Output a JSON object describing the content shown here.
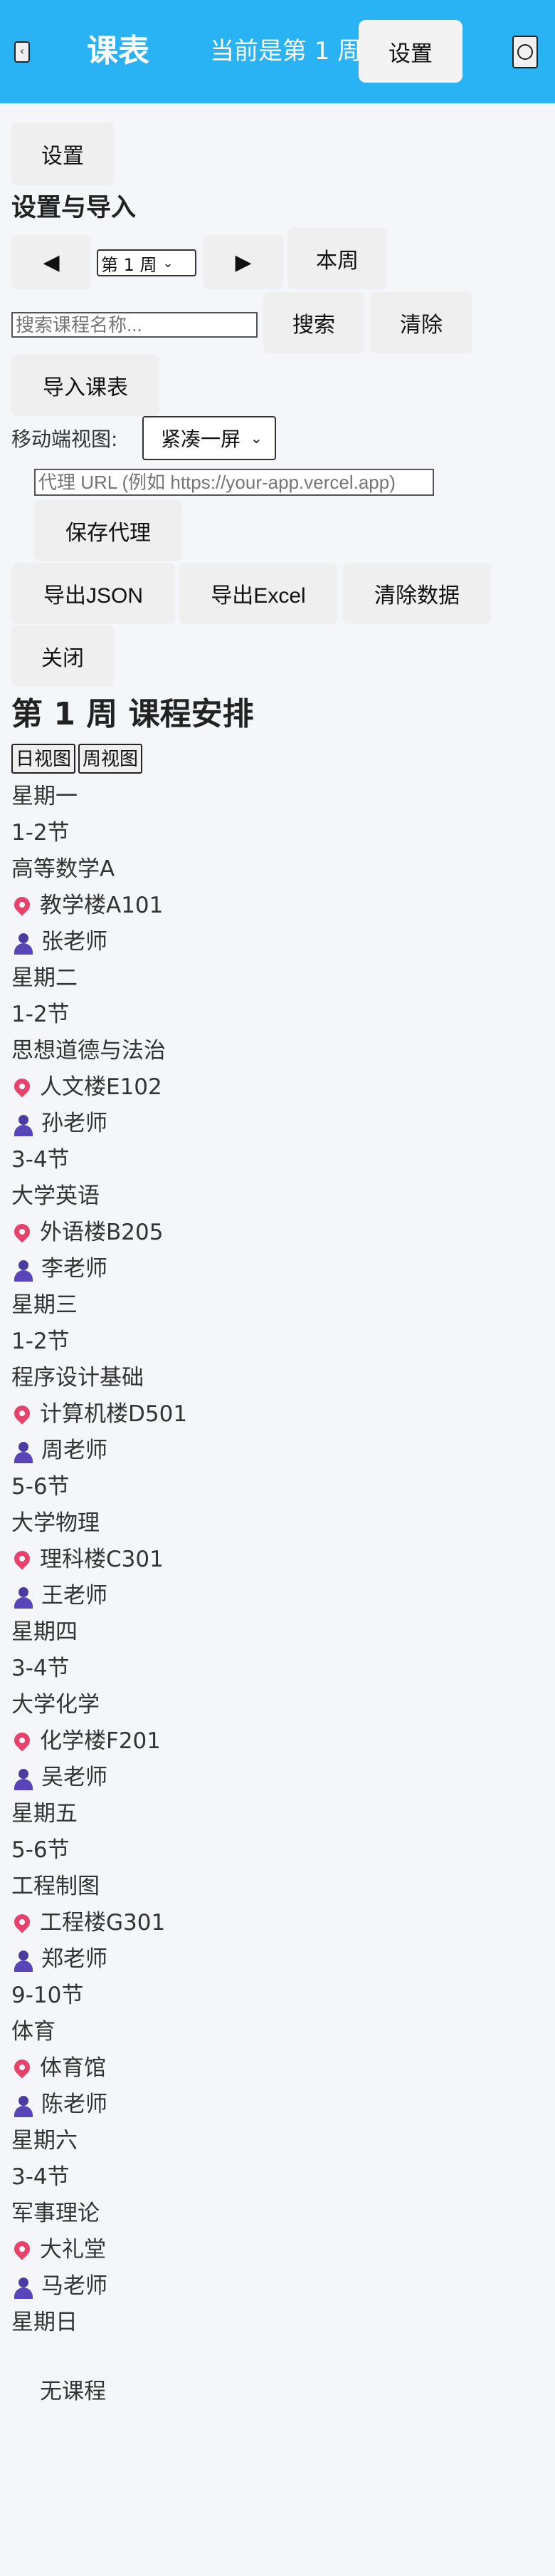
{
  "header": {
    "back_icon": "chevron-left-icon",
    "title": "课表",
    "week_info": "当前是第 1 周",
    "settings_label": "设置",
    "help_icon": "circle-icon"
  },
  "settings_toggle_label": "设置",
  "settings_panel": {
    "title": "设置与导入",
    "prev_label": "◀",
    "week_select_value": "第 1 周",
    "next_label": "▶",
    "this_week_label": "本周",
    "search_placeholder": "搜索课程名称...",
    "search_label": "搜索",
    "clear_label": "清除",
    "import_label": "导入课表",
    "mobile_view_label": "移动端视图:",
    "mobile_view_value": "紧凑一屏",
    "proxy_placeholder": "代理 URL (例如 https://your-app.vercel.app)",
    "save_proxy_label": "保存代理",
    "export_json_label": "导出JSON",
    "export_excel_label": "导出Excel",
    "clear_data_label": "清除数据",
    "close_label": "关闭"
  },
  "schedule": {
    "title": "第 1 周 课程安排",
    "day_view_label": "日视图",
    "week_view_label": "周视图",
    "days": [
      {
        "name": "星期一",
        "courses": [
          {
            "period": "1-2节",
            "name": "高等数学A",
            "location": "教学楼A101",
            "teacher": "张老师"
          }
        ]
      },
      {
        "name": "星期二",
        "courses": [
          {
            "period": "1-2节",
            "name": "思想道德与法治",
            "location": "人文楼E102",
            "teacher": "孙老师"
          },
          {
            "period": "3-4节",
            "name": "大学英语",
            "location": "外语楼B205",
            "teacher": "李老师"
          }
        ]
      },
      {
        "name": "星期三",
        "courses": [
          {
            "period": "1-2节",
            "name": "程序设计基础",
            "location": "计算机楼D501",
            "teacher": "周老师"
          },
          {
            "period": "5-6节",
            "name": "大学物理",
            "location": "理科楼C301",
            "teacher": "王老师"
          }
        ]
      },
      {
        "name": "星期四",
        "courses": [
          {
            "period": "3-4节",
            "name": "大学化学",
            "location": "化学楼F201",
            "teacher": "吴老师"
          }
        ]
      },
      {
        "name": "星期五",
        "courses": [
          {
            "period": "5-6节",
            "name": "工程制图",
            "location": "工程楼G301",
            "teacher": "郑老师"
          },
          {
            "period": "9-10节",
            "name": "体育",
            "location": "体育馆",
            "teacher": "陈老师"
          }
        ]
      },
      {
        "name": "星期六",
        "courses": [
          {
            "period": "3-4节",
            "name": "军事理论",
            "location": "大礼堂",
            "teacher": "马老师"
          }
        ]
      },
      {
        "name": "星期日",
        "courses": [],
        "empty_label": "无课程"
      }
    ]
  },
  "colors": {
    "header_bg": "#29b3f5",
    "button_bg": "#efefef",
    "page_bg": "#f4f6f9",
    "pin": "#e8416b",
    "person": "#5a45b8"
  }
}
